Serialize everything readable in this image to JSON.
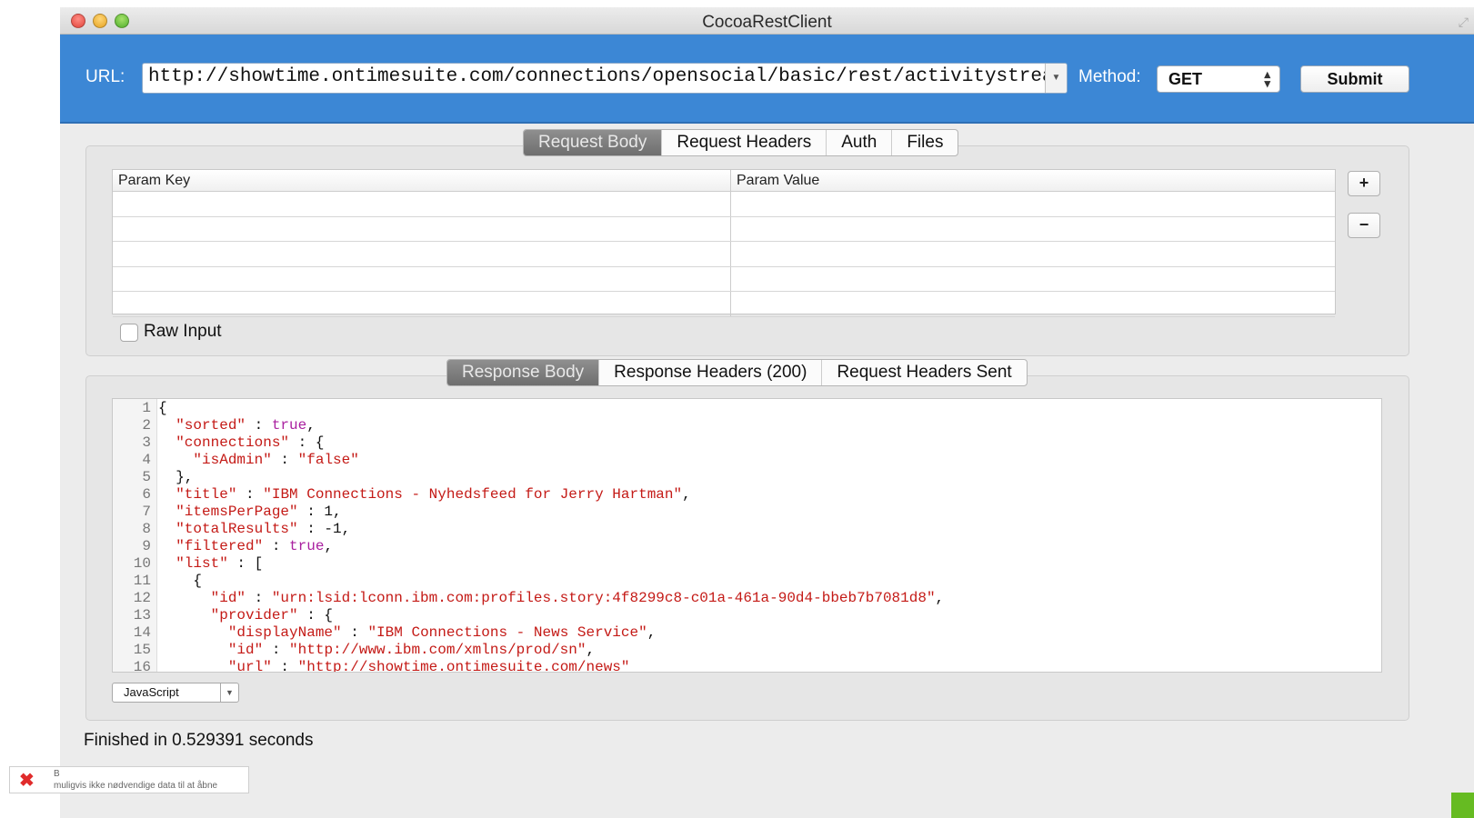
{
  "window": {
    "title": "CocoaRestClient"
  },
  "urlbar": {
    "url_label": "URL:",
    "url_value": "http://showtime.ontimesuite.com/connections/opensocial/basic/rest/activitystreams/@me",
    "method_label": "Method:",
    "method_value": "GET",
    "submit_label": "Submit"
  },
  "request": {
    "tabs": [
      "Request Body",
      "Request Headers",
      "Auth",
      "Files"
    ],
    "active_tab": "Request Body",
    "table_headers": [
      "Param Key",
      "Param Value"
    ],
    "add_label": "+",
    "remove_label": "−",
    "raw_input_label": "Raw Input",
    "raw_input_checked": false
  },
  "response": {
    "tabs": [
      "Response Body",
      "Response Headers (200)",
      "Request Headers Sent"
    ],
    "active_tab": "Response Body",
    "language": "JavaScript",
    "lines": [
      "{",
      "  \"sorted\" : true,",
      "  \"connections\" : {",
      "    \"isAdmin\" : \"false\"",
      "  },",
      "  \"title\" : \"IBM Connections - Nyhedsfeed for Jerry Hartman\",",
      "  \"itemsPerPage\" : 1,",
      "  \"totalResults\" : -1,",
      "  \"filtered\" : true,",
      "  \"list\" : [",
      "    {",
      "      \"id\" : \"urn:lsid:lconn.ibm.com:profiles.story:4f8299c8-c01a-461a-90d4-bbeb7b7081d8\",",
      "      \"provider\" : {",
      "        \"displayName\" : \"IBM Connections - News Service\",",
      "        \"id\" : \"http://www.ibm.com/xmlns/prod/sn\",",
      "        \"url\" : \"http://showtime.ontimesuite.com/news\""
    ]
  },
  "status": {
    "text": "Finished in 0.529391 seconds"
  },
  "bottom_bar": {
    "text1": "B",
    "text2": "muligvis ikke nødvendige data til at åbne"
  },
  "colors": {
    "urlbar_bg": "#3c87d5",
    "string": "#c41a16",
    "keyword": "#a91f9f"
  }
}
